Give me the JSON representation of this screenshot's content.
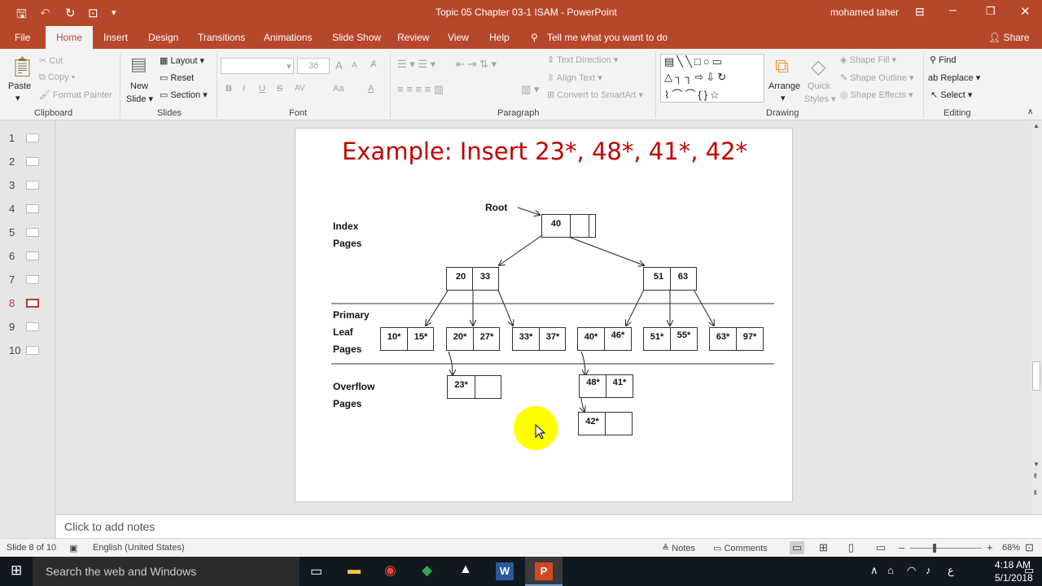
{
  "window": {
    "title": "Topic 05 Chapter 03-1 ISAM  -  PowerPoint",
    "user": "mohamed taher"
  },
  "tabs": [
    "File",
    "Home",
    "Insert",
    "Design",
    "Transitions",
    "Animations",
    "Slide Show",
    "Review",
    "View",
    "Help"
  ],
  "tell_me": "Tell me what you want to do",
  "share": "Share",
  "ribbon": {
    "clipboard": {
      "paste": "Paste",
      "cut": "Cut",
      "copy": "Copy",
      "format_painter": "Format Painter",
      "group": "Clipboard"
    },
    "slides": {
      "new_slide_1": "New",
      "new_slide_2": "Slide",
      "layout": "Layout",
      "reset": "Reset",
      "section": "Section",
      "group": "Slides"
    },
    "font": {
      "size": "36",
      "bold": "B",
      "italic": "I",
      "underline": "U",
      "strike": "S",
      "spacing": "AV",
      "case": "Aa",
      "color": "A",
      "grow": "A",
      "shrink": "A",
      "group": "Font"
    },
    "paragraph": {
      "text_direction": "Text Direction",
      "align_text": "Align Text",
      "convert_smartart": "Convert to SmartArt",
      "group": "Paragraph"
    },
    "drawing": {
      "arrange": "Arrange",
      "quick_styles_1": "Quick",
      "quick_styles_2": "Styles",
      "shape_fill": "Shape Fill",
      "shape_outline": "Shape Outline",
      "shape_effects": "Shape Effects",
      "group": "Drawing"
    },
    "editing": {
      "find": "Find",
      "replace": "Replace",
      "select": "Select",
      "group": "Editing"
    }
  },
  "thumbnails": [
    "1",
    "2",
    "3",
    "4",
    "5",
    "6",
    "7",
    "8",
    "9",
    "10"
  ],
  "selected_slide": "8",
  "slide": {
    "title": "Example: Insert 23*, 48*, 41*, 42*",
    "root_label": "Root",
    "index_label": [
      "Index",
      "Pages"
    ],
    "primary_label": [
      "Primary",
      "Leaf",
      "Pages"
    ],
    "overflow_label": [
      "Overflow",
      "Pages"
    ],
    "root_node": [
      "40"
    ],
    "left_node": [
      "20",
      "33"
    ],
    "right_node": [
      "51",
      "63"
    ],
    "leaves": [
      [
        "10*",
        "15*"
      ],
      [
        "20*",
        "27*"
      ],
      [
        "33*",
        "37*"
      ],
      [
        "40*",
        "46*"
      ],
      [
        "51*",
        "55*"
      ],
      [
        "63*",
        "97*"
      ]
    ],
    "overflow": [
      [
        "23*",
        ""
      ],
      [
        "48*",
        "41*"
      ],
      [
        "42*",
        ""
      ]
    ]
  },
  "notes_placeholder": "Click to add notes",
  "status": {
    "slide": "Slide 8 of 10",
    "language": "English (United States)",
    "notes": "Notes",
    "comments": "Comments",
    "zoom": "68%"
  },
  "taskbar": {
    "search": "Search the web and Windows",
    "time": "4:18 AM",
    "date": "5/1/2018",
    "lang": "ع"
  },
  "colors": {
    "accent": "#b7472a",
    "title_red": "#c00000",
    "cursor_highlight": "#ffff00"
  }
}
